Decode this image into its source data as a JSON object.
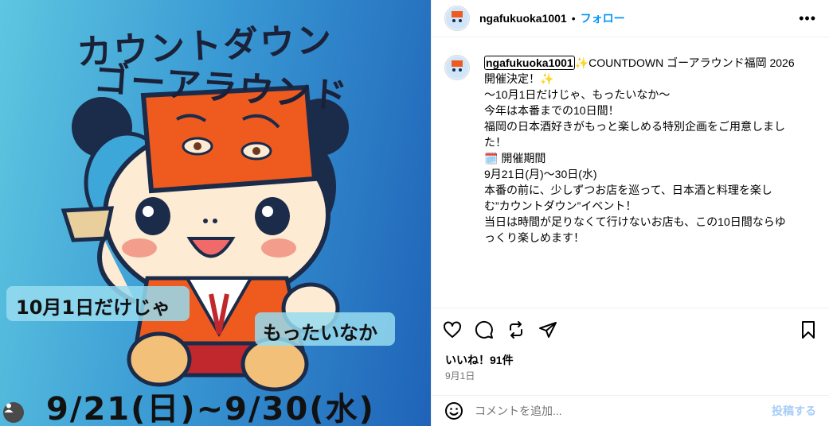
{
  "media": {
    "title_line1": "カウントダウン",
    "title_line2": "ゴーアラウンド",
    "banner_left": "10月1日だけじゃ",
    "banner_right": "もったいなか",
    "date_range": "9/21(日)~9/30(水)"
  },
  "post": {
    "username": "ngafukuoka1001",
    "dot": "•",
    "follow_label": "フォロー",
    "more_label": "•••",
    "caption_user": "ngafukuoka1001",
    "caption_lines": [
      "✨COUNTDOWN ゴーアラウンド福岡 2026 開催決定！✨",
      "",
      "〜10月1日だけじゃ、もったいなか〜",
      "",
      "今年は本番までの10日間！",
      "福岡の日本酒好きがもっと楽しめる特別企画をご用意しました！",
      "",
      "🗓️ 開催期間",
      "9月21日(月)〜30日(水)",
      "",
      "本番の前に、少しずつお店を巡って、日本酒と料理を楽しむ”カウントダウン”イベント！",
      "",
      "当日は時間が足りなくて行けないお店も、この10日間ならゆっくり楽しめます！"
    ],
    "likes_text": "いいね！91件",
    "date_text": "9月1日"
  },
  "comment": {
    "placeholder": "コメントを追加...",
    "post_label": "投稿する"
  },
  "icons": {
    "like": "heart-icon",
    "comment": "comment-icon",
    "repost": "repost-icon",
    "share": "share-icon",
    "save": "bookmark-icon",
    "emoji": "emoji-icon",
    "more": "more-icon",
    "person": "person-icon"
  },
  "colors": {
    "accent": "#0095f6",
    "muted": "#737373",
    "post_disabled": "#a8cdf7",
    "mascot_orange": "#ef5a1f"
  }
}
